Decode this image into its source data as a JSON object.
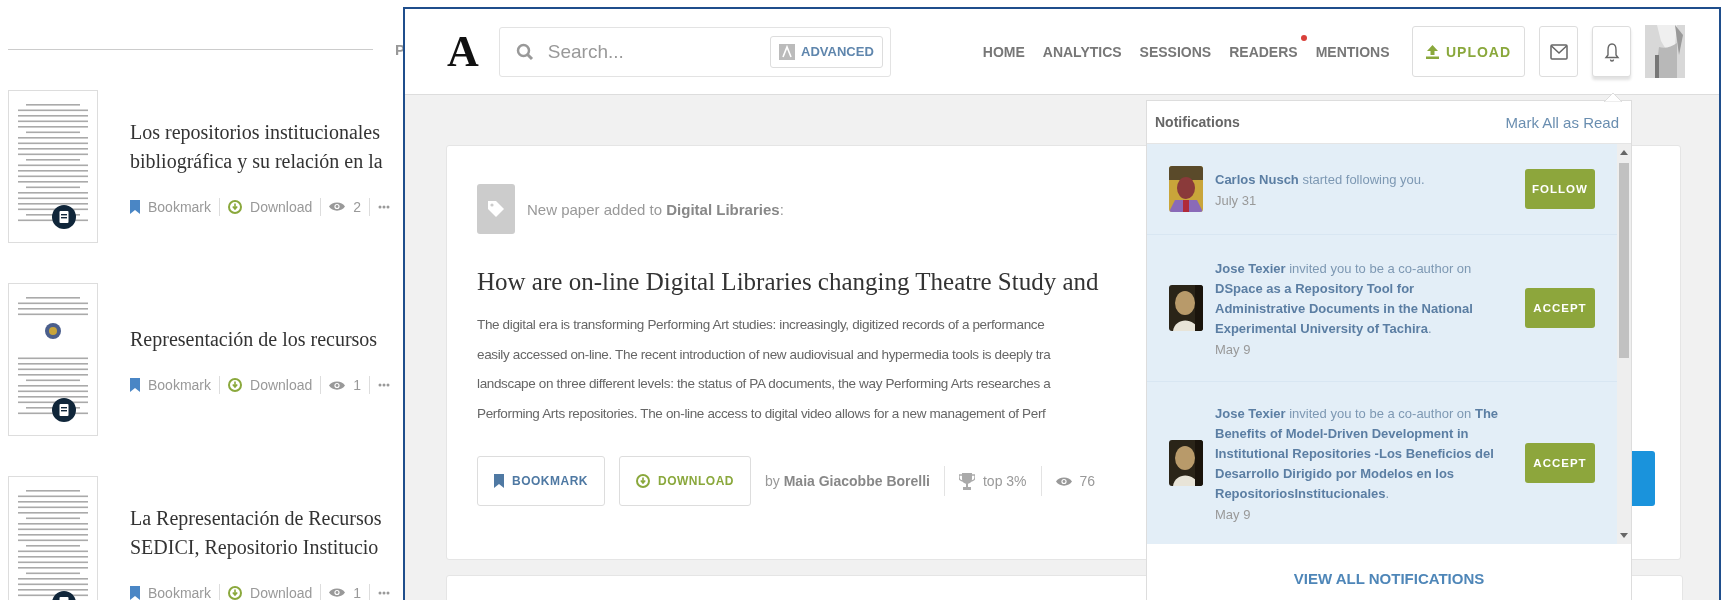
{
  "background_page": {
    "section_label": "P",
    "papers": [
      {
        "title_lines": [
          "Los repositorios institucionales",
          "bibliográfica y su relación en la"
        ],
        "bookmark": "Bookmark",
        "download": "Download",
        "views": "2",
        "emblem": false
      },
      {
        "title_lines": [
          "Representación de los recursos"
        ],
        "bookmark": "Bookmark",
        "download": "Download",
        "views": "1",
        "emblem": true
      },
      {
        "title_lines": [
          "La Representación de Recursos",
          "SEDICI, Repositorio Institucio"
        ],
        "bookmark": "Bookmark",
        "download": "Download",
        "views": "1",
        "emblem": false
      }
    ]
  },
  "window": {
    "logo": "A",
    "search": {
      "placeholder": "Search...",
      "advanced": "ADVANCED"
    },
    "nav": [
      {
        "label": "HOME",
        "dot": false
      },
      {
        "label": "ANALYTICS",
        "dot": false
      },
      {
        "label": "SESSIONS",
        "dot": false
      },
      {
        "label": "READERS",
        "dot": true
      },
      {
        "label": "MENTIONS",
        "dot": false
      }
    ],
    "upload": "UPLOAD"
  },
  "feed_card": {
    "intro": "New paper added to **Digital Libraries**:",
    "title": "How are on-line Digital Libraries changing Theatre Study and",
    "abstract_lines": [
      "The digital era is transforming Performing Art studies: increasingly, digitized records of a performance",
      "easily accessed on-line. The recent introduction of new audiovisual and hypermedia tools is deeply tra",
      "landscape on three different levels: the status of PA documents, the way Performing Arts researches a",
      "Performing Arts repositories. The on-line access to digital video allows for a new management of Perf"
    ],
    "bookmark": "BOOKMARK",
    "download": "DOWNLOAD",
    "byline": "by **Maia Giacobbe Borelli**",
    "rank": "top 3%",
    "views": "76"
  },
  "notifications": {
    "title": "Notifications",
    "mark_all": "Mark All as Read",
    "items": [
      {
        "text": "**Carlos Nusch** started following you.",
        "date": "July 31",
        "action": "FOLLOW",
        "unread": true
      },
      {
        "text": "**Jose Texier** invited you to be a co-author on **DSpace as a Repository Tool for Administrative Documents in the National Experimental University of Tachira**.",
        "date": "May 9",
        "action": "ACCEPT",
        "unread": true
      },
      {
        "text": "**Jose Texier** invited you to be a co-author on **The Benefits of Model-Driven Development in Institutional Repositories -Los Beneficios del Desarrollo Dirigido por Modelos en los RepositoriosInstitucionales**.",
        "date": "May 9",
        "action": "ACCEPT",
        "unread": true
      }
    ],
    "view_all": "VIEW ALL NOTIFICATIONS"
  }
}
